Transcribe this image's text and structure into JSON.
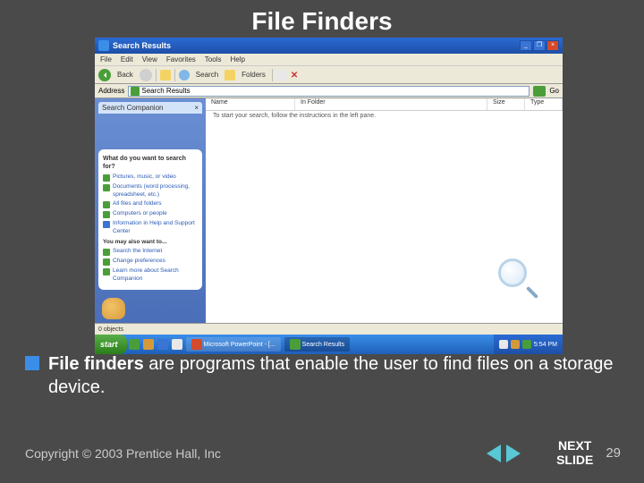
{
  "slide": {
    "title": "File Finders",
    "bullet_strong": "File finders",
    "bullet_rest": " are programs that enable the user to find files on a storage device.",
    "copyright": "Copyright © 2003 Prentice Hall, Inc",
    "next_label": "NEXT\nSLIDE",
    "page_number": "29"
  },
  "window": {
    "title": "Search Results",
    "menus": [
      "File",
      "Edit",
      "View",
      "Favorites",
      "Tools",
      "Help"
    ],
    "toolbar": {
      "back": "Back",
      "search": "Search",
      "folders": "Folders"
    },
    "address_label": "Address",
    "address_value": "Search Results",
    "go": "Go",
    "panel_title": "Search Companion",
    "balloon": {
      "heading": "What do you want to search for?",
      "opts": [
        "Pictures, music, or video",
        "Documents (word processing, spreadsheet, etc.)",
        "All files and folders",
        "Computers or people",
        "Information in Help and Support Center"
      ],
      "subhead": "You may also want to...",
      "subopts": [
        "Search the Internet",
        "Change preferences",
        "Learn more about Search Companion"
      ]
    },
    "columns": {
      "name": "Name",
      "folder": "In Folder",
      "size": "Size",
      "type": "Type"
    },
    "instruction": "To start your search, follow the instructions in the left pane.",
    "status": "0 objects",
    "taskbar": {
      "start": "start",
      "items": [
        "Microsoft PowerPoint - [...",
        "Search Results"
      ],
      "clock": "5:54 PM"
    }
  }
}
